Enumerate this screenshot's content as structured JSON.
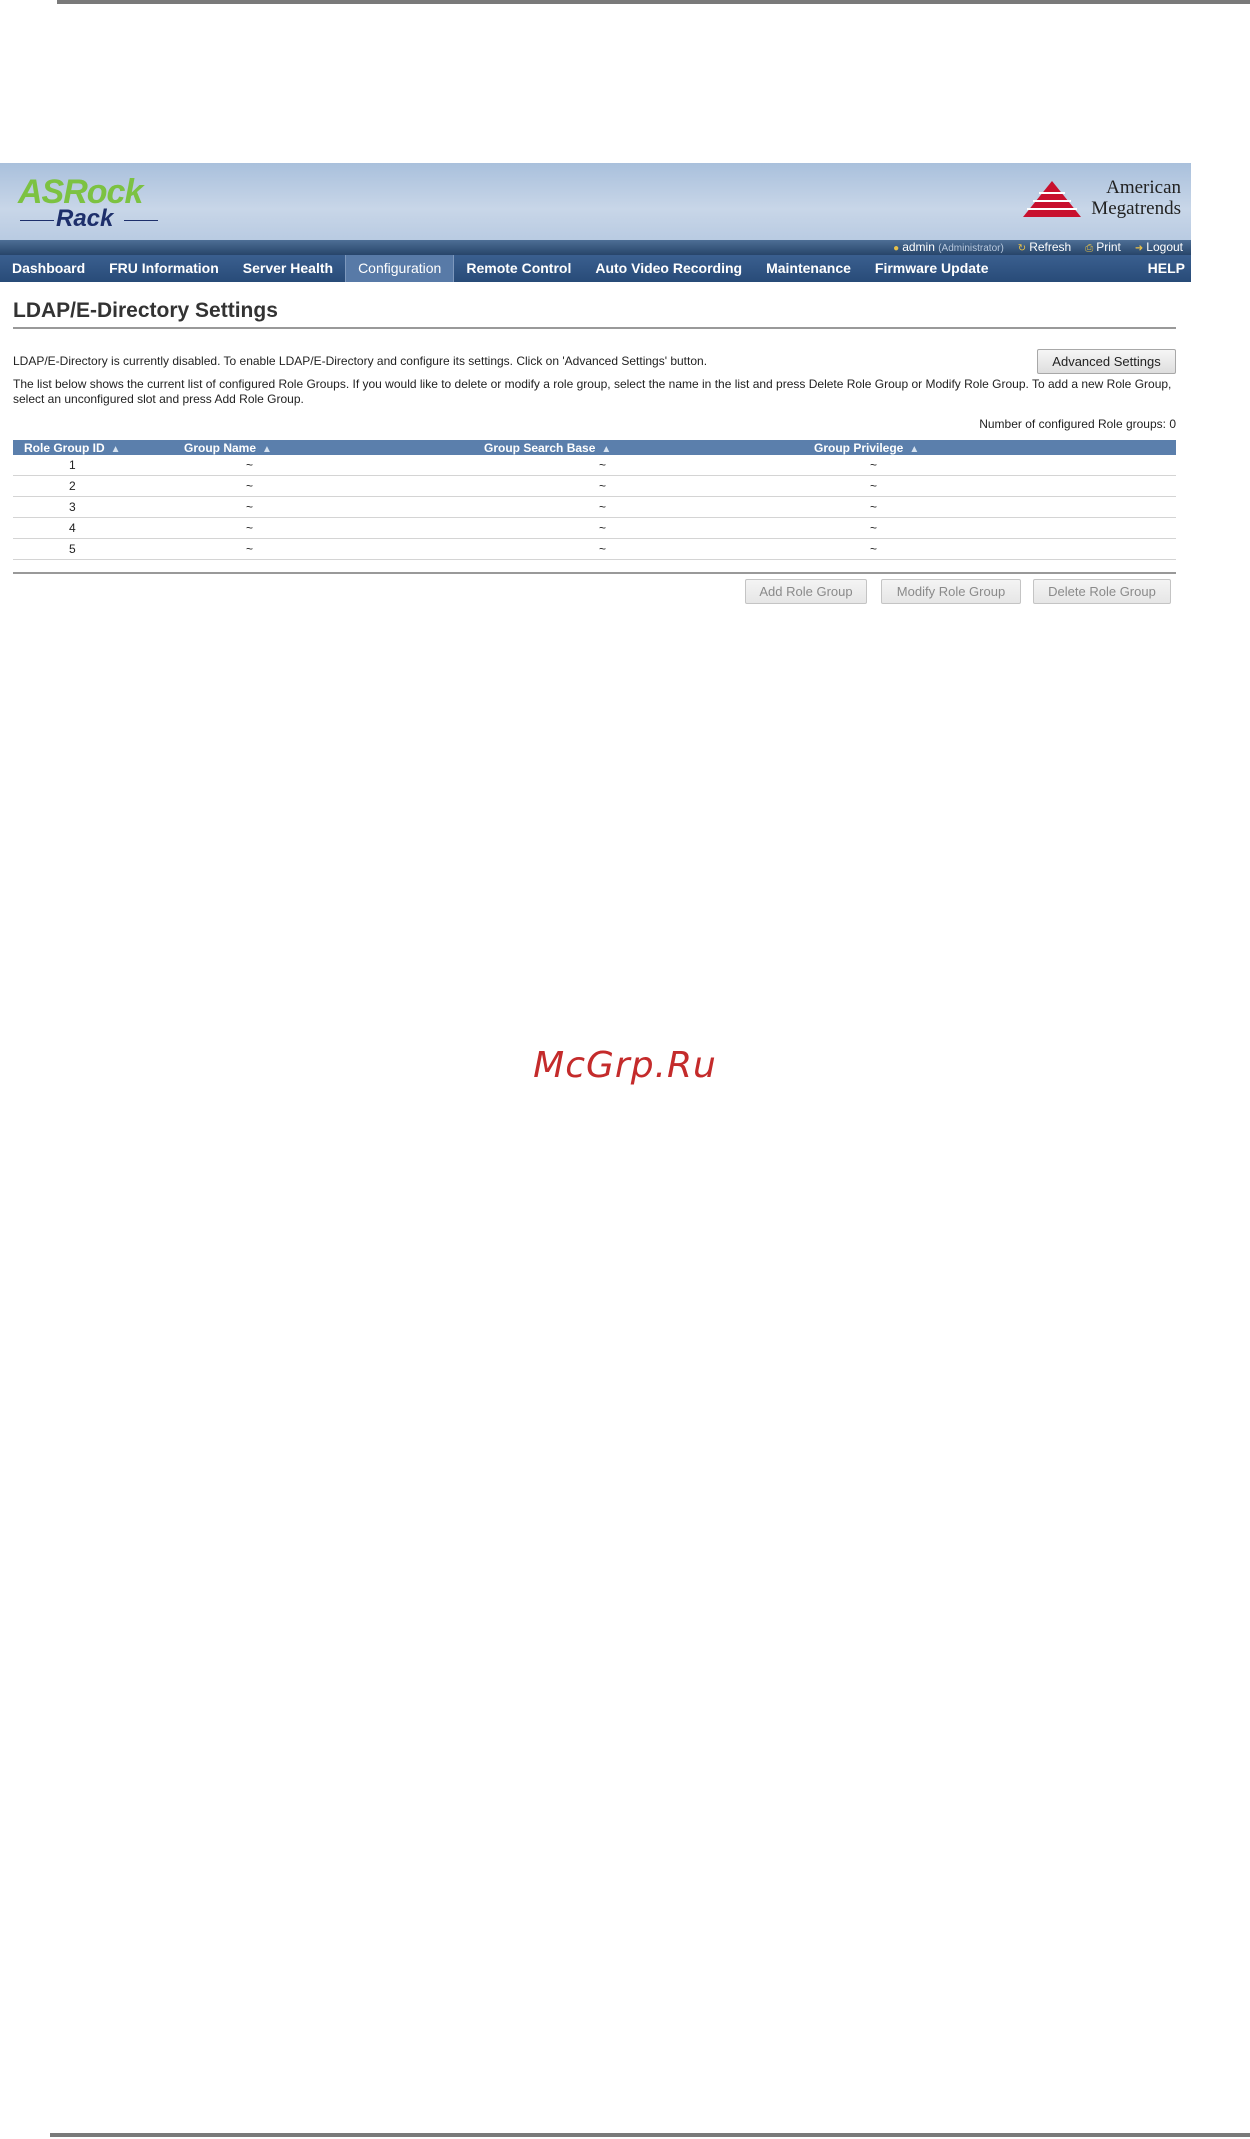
{
  "header": {
    "brand_top": "ASRock",
    "brand_bottom": "Rack",
    "vendor_line1": "American",
    "vendor_line2": "Megatrends"
  },
  "userbar": {
    "user": "admin",
    "role": "(Administrator)",
    "refresh_label": "Refresh",
    "print_label": "Print",
    "logout_label": "Logout"
  },
  "nav": {
    "items": [
      {
        "label": "Dashboard"
      },
      {
        "label": "FRU Information"
      },
      {
        "label": "Server Health"
      },
      {
        "label": "Configuration"
      },
      {
        "label": "Remote Control"
      },
      {
        "label": "Auto Video Recording"
      },
      {
        "label": "Maintenance"
      },
      {
        "label": "Firmware Update"
      }
    ],
    "help_label": "HELP"
  },
  "page": {
    "title": "LDAP/E-Directory Settings",
    "status_text": "LDAP/E-Directory is currently disabled. To enable LDAP/E-Directory and configure its settings. Click on 'Advanced Settings' button.",
    "advanced_button": "Advanced Settings",
    "description": "The list below shows the current list of configured Role Groups. If you would like to delete or modify a role group, select the name in the list and press Delete Role Group or Modify Role Group. To add a new Role Group, select an unconfigured slot and press Add Role Group.",
    "count_text": "Number of configured Role groups: 0"
  },
  "table": {
    "columns": [
      "Role Group ID",
      "Group Name",
      "Group Search Base",
      "Group Privilege"
    ],
    "sort_glyph": "▲",
    "rows": [
      [
        "1",
        "~",
        "~",
        "~"
      ],
      [
        "2",
        "~",
        "~",
        "~"
      ],
      [
        "3",
        "~",
        "~",
        "~"
      ],
      [
        "4",
        "~",
        "~",
        "~"
      ],
      [
        "5",
        "~",
        "~",
        "~"
      ]
    ]
  },
  "actions": {
    "add": "Add Role Group",
    "modify": "Modify Role Group",
    "delete": "Delete Role Group"
  },
  "watermark": "McGrp.Ru"
}
